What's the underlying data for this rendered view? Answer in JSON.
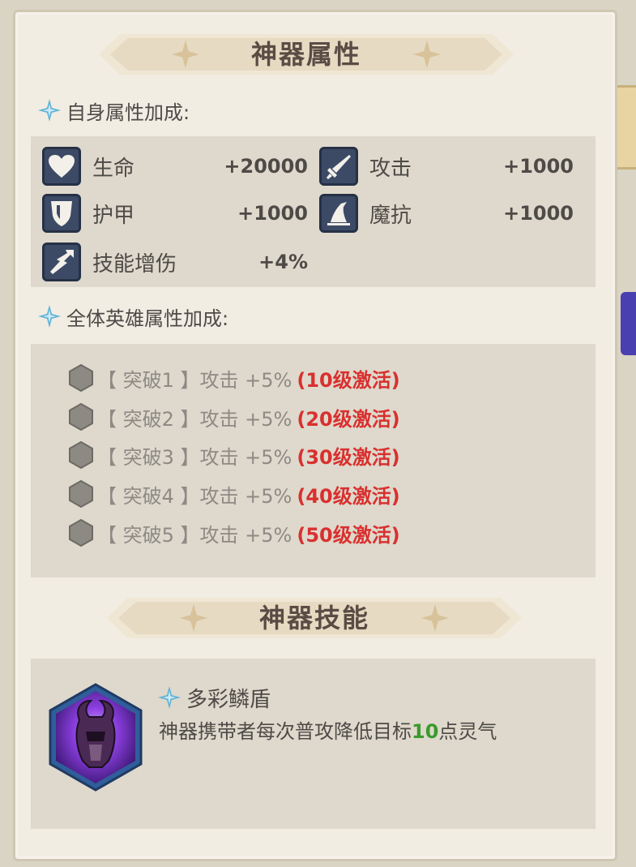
{
  "panel": {
    "artifact_attributes_title": "神器属性",
    "artifact_skill_title": "神器技能"
  },
  "self_bonus": {
    "label": "自身属性加成:",
    "stats": [
      {
        "icon": "heart-icon",
        "name": "生命",
        "value": "+20000"
      },
      {
        "icon": "sword-icon",
        "name": "攻击",
        "value": "+1000"
      },
      {
        "icon": "shield-icon",
        "name": "护甲",
        "value": "+1000"
      },
      {
        "icon": "wizard-hat-icon",
        "name": "魔抗",
        "value": "+1000"
      },
      {
        "icon": "skill-damage-icon",
        "name": "技能增伤",
        "value": "+4%"
      }
    ]
  },
  "team_bonus": {
    "label": "全体英雄属性加成:",
    "breakthroughs": [
      {
        "text": "【 突破1 】攻击 +5%",
        "activation": "(10级激活)"
      },
      {
        "text": "【 突破2 】攻击 +5%",
        "activation": "(20级激活)"
      },
      {
        "text": "【 突破3 】攻击 +5%",
        "activation": "(30级激活)"
      },
      {
        "text": "【 突破4 】攻击 +5%",
        "activation": "(40级激活)"
      },
      {
        "text": "【 突破5 】攻击 +5%",
        "activation": "(50级激活)"
      }
    ]
  },
  "skill": {
    "icon": "horned-helmet-icon",
    "name": "多彩鳞盾",
    "desc_before": "神器携带者每次普攻降低目标",
    "desc_number": "10",
    "desc_after": "点灵气"
  },
  "colors": {
    "panel_bg": "#f1ede3",
    "box_bg": "#ded9cc",
    "text": "#4e4a47",
    "muted": "#8e8a85",
    "activation_red": "#d9302f",
    "highlight_green": "#3b9a2c",
    "icon_bg": "#3d4a66"
  }
}
